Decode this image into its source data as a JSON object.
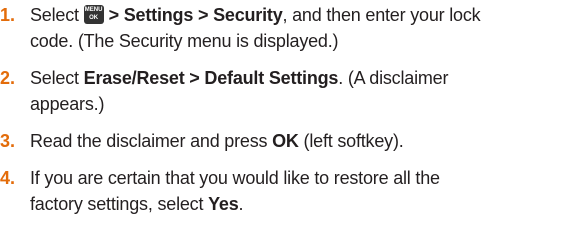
{
  "steps": [
    {
      "number": "1.",
      "menu_key_icon": "menu-ok-key-icon",
      "menu_key_top": "MENU",
      "menu_key_bottom": "OK",
      "pre": "Select",
      "bold": "> Settings > Security",
      "post": ", and then enter your lock",
      "line2": "code. (The Security menu is displayed.)"
    },
    {
      "number": "2.",
      "pre": "Select ",
      "bold": "Erase/Reset > Default Settings",
      "post": ". (A disclaimer",
      "line2": "appears.)"
    },
    {
      "number": "3.",
      "pre": "Read the disclaimer and press ",
      "bold": "OK",
      "post": " (left softkey)."
    },
    {
      "number": "4.",
      "pre": "If you are certain that you would like to restore all the",
      "line2_pre": "factory settings, select ",
      "bold": "Yes",
      "post": "."
    }
  ],
  "colors": {
    "step_number": "#e36c0a",
    "text": "#231f20",
    "menu_key": "#333333"
  }
}
